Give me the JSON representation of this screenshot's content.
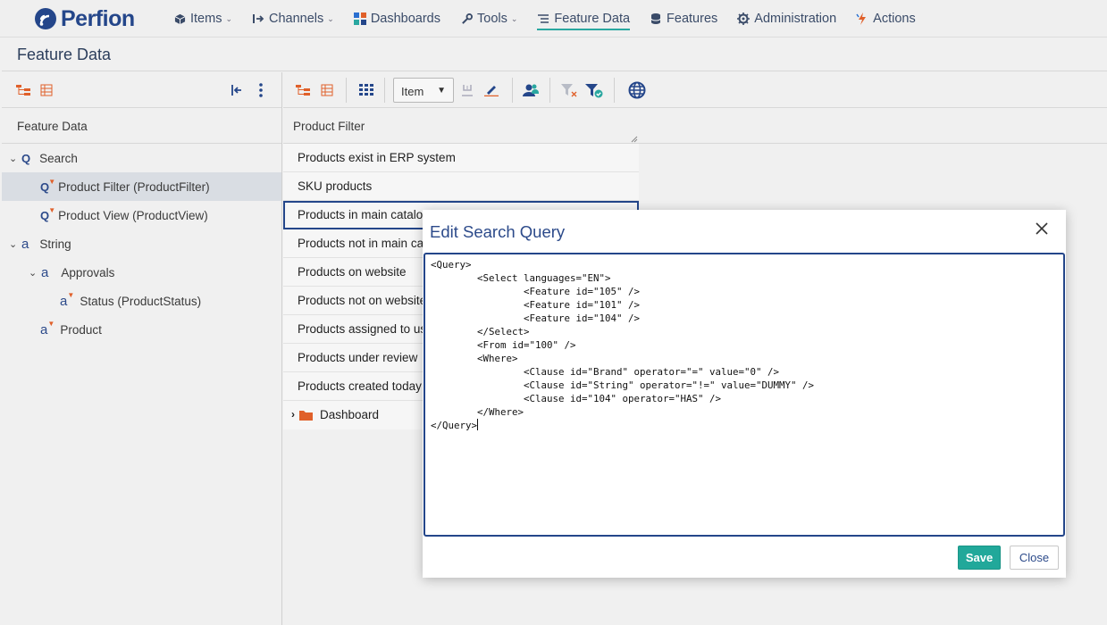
{
  "app": {
    "logo_text": "Perfion"
  },
  "nav": [
    {
      "label": "Items",
      "icon": "cube-icon",
      "dropdown": true
    },
    {
      "label": "Channels",
      "icon": "channels-icon",
      "dropdown": true
    },
    {
      "label": "Dashboards",
      "icon": "dashboard-icon",
      "dropdown": false
    },
    {
      "label": "Tools",
      "icon": "wrench-icon",
      "dropdown": true
    },
    {
      "label": "Feature Data",
      "icon": "list-icon",
      "dropdown": false,
      "active": true
    },
    {
      "label": "Features",
      "icon": "database-icon",
      "dropdown": false
    },
    {
      "label": "Administration",
      "icon": "gear-icon",
      "dropdown": false
    },
    {
      "label": "Actions",
      "icon": "lightning-icon",
      "dropdown": false
    }
  ],
  "page_title": "Feature Data",
  "left_panel": {
    "header": "Feature Data",
    "tree": [
      {
        "label": "Search",
        "type": "search",
        "expanded": true,
        "level": 0
      },
      {
        "label": "Product Filter (ProductFilter)",
        "type": "query",
        "level": 1,
        "selected": true
      },
      {
        "label": "Product View (ProductView)",
        "type": "query",
        "level": 1
      },
      {
        "label": "String",
        "type": "string",
        "expanded": true,
        "level": 0
      },
      {
        "label": "Approvals",
        "type": "string",
        "expanded": true,
        "level": 1
      },
      {
        "label": "Status (ProductStatus)",
        "type": "feature",
        "level": 2
      },
      {
        "label": "Product",
        "type": "feature",
        "level": 1
      }
    ]
  },
  "right_panel": {
    "item_select": "Item",
    "header": "Product Filter",
    "list": [
      "Products exist in ERP system",
      "SKU products",
      "Products in main catalog",
      "Products not in main catalog",
      "Products on website",
      "Products not on website",
      "Products assigned to user",
      "Products under review",
      "Products created today"
    ],
    "selected_index": 2,
    "folder": "Dashboard"
  },
  "dialog": {
    "title": "Edit Search Query",
    "query_text": "<Query>\n\t<Select languages=\"EN\">\n\t\t<Feature id=\"105\" />\n\t\t<Feature id=\"101\" />\n\t\t<Feature id=\"104\" />\n\t</Select>\n\t<From id=\"100\" />\n\t<Where>\n\t\t<Clause id=\"Brand\" operator=\"=\" value=\"0\" />\n\t\t<Clause id=\"String\" operator=\"!=\" value=\"DUMMY\" />\n\t\t<Clause id=\"104\" operator=\"HAS\" />\n\t</Where>\n</Query>",
    "save_label": "Save",
    "close_label": "Close"
  },
  "colors": {
    "brand": "#24468a",
    "accent": "#21a89a",
    "marker": "#e0602a"
  }
}
